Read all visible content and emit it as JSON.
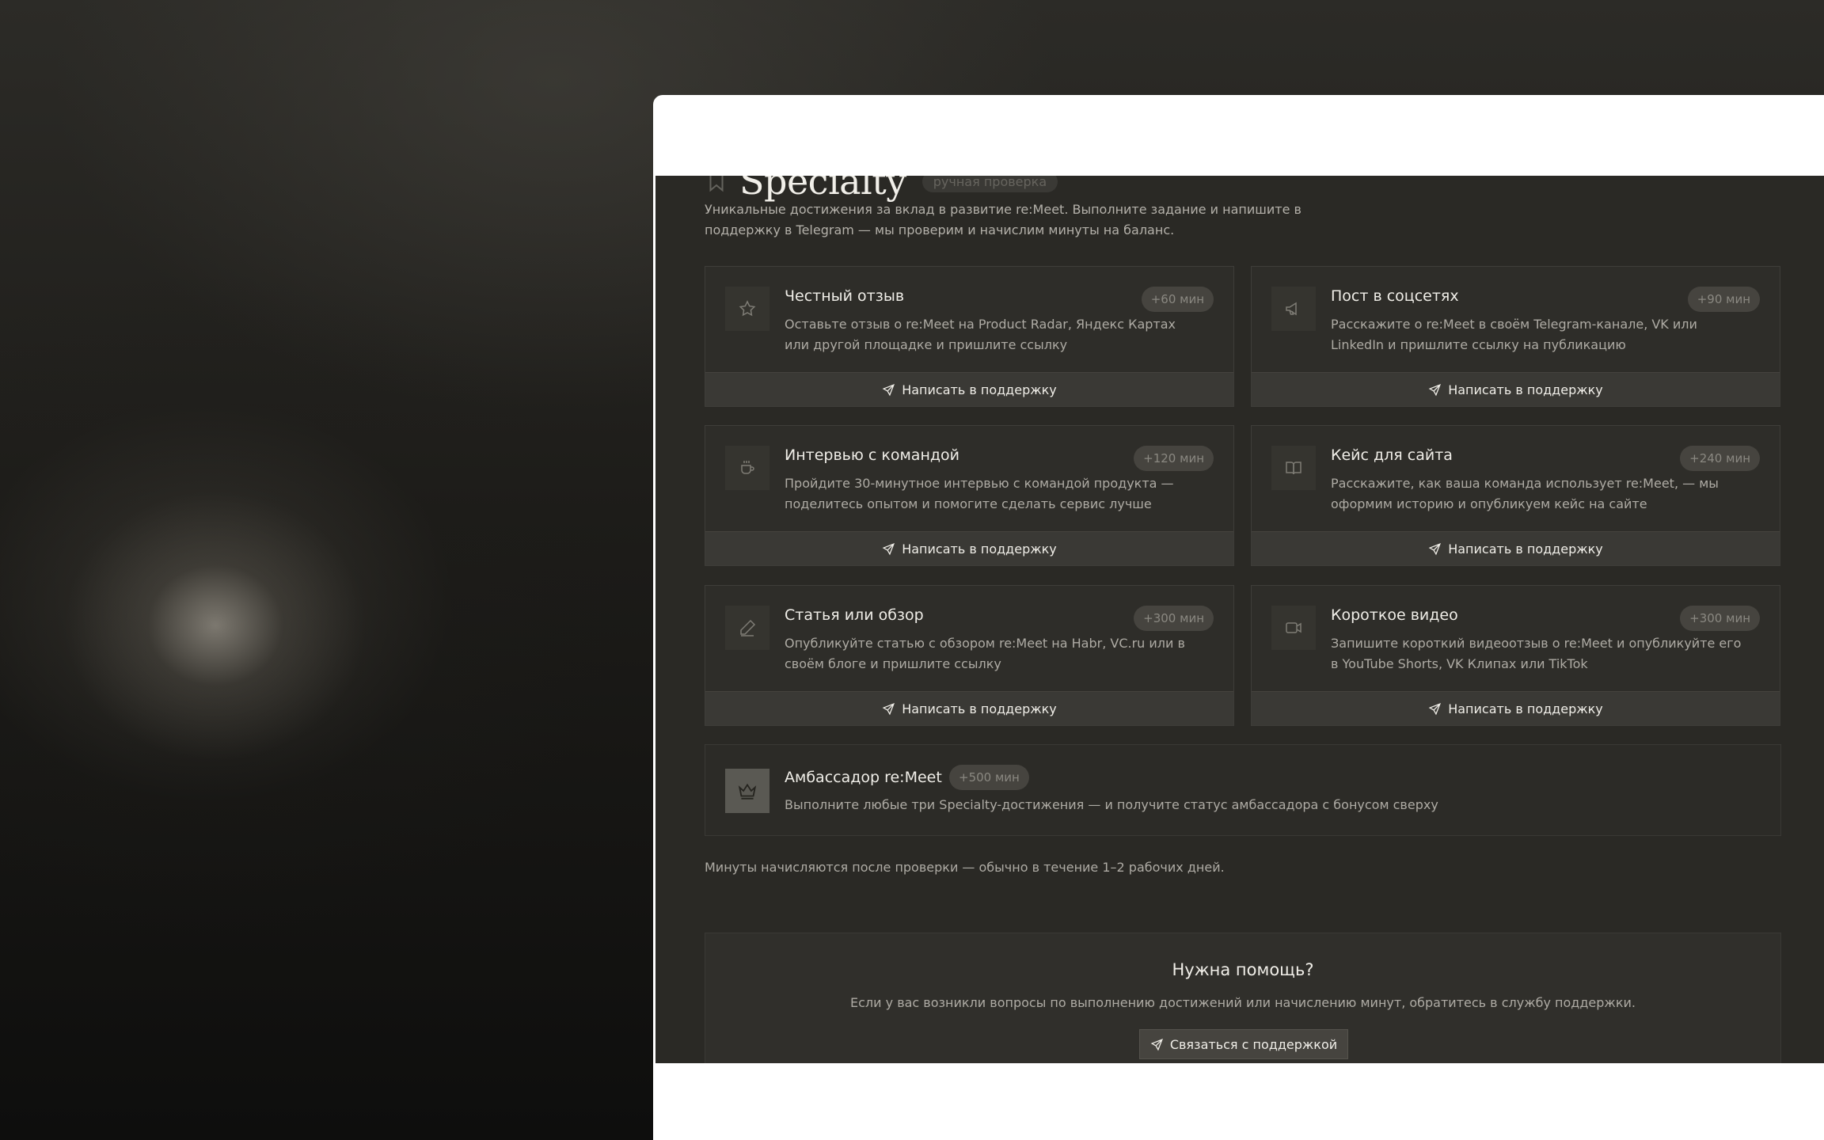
{
  "header": {
    "title": "Specialty",
    "badge": "ручная проверка",
    "intro": "Уникальные достижения за вклад в развитие re:Meet. Выполните задание и напишите в поддержку в Telegram — мы проверим и начислим минуты на баланс."
  },
  "cards": [
    {
      "icon": "star-icon",
      "title": "Честный отзыв",
      "reward": "+60 мин",
      "desc": "Оставьте отзыв о re:Meet на Product Radar, Яндекс Картах или другой площадке и пришлите ссылку",
      "button": "Написать в поддержку"
    },
    {
      "icon": "megaphone-icon",
      "title": "Пост в соцсетях",
      "reward": "+90 мин",
      "desc": "Расскажите о re:Meet в своём Telegram-канале, VK или LinkedIn и пришлите ссылку на публикацию",
      "button": "Написать в поддержку"
    },
    {
      "icon": "coffee-icon",
      "title": "Интервью с командой",
      "reward": "+120 мин",
      "desc": "Пройдите 30-минутное интервью с командой продукта — поделитесь опытом и помогите сделать сервис лучше",
      "button": "Написать в поддержку"
    },
    {
      "icon": "book-icon",
      "title": "Кейс для сайта",
      "reward": "+240 мин",
      "desc": "Расскажите, как ваша команда использует re:Meet, — мы оформим историю и опубликуем кейс на сайте",
      "button": "Написать в поддержку"
    },
    {
      "icon": "pen-icon",
      "title": "Статья или обзор",
      "reward": "+300 мин",
      "desc": "Опубликуйте статью с обзором re:Meet на Habr, VC.ru или в своём блоге и пришлите ссылку",
      "button": "Написать в поддержку"
    },
    {
      "icon": "video-icon",
      "title": "Короткое видео",
      "reward": "+300 мин",
      "desc": "Запишите короткий видеоотзыв о re:Meet и опубликуйте его в YouTube Shorts, VK Клипах или TikTok",
      "button": "Написать в поддержку"
    }
  ],
  "ambassador": {
    "icon": "crown-icon",
    "title": "Амбассадор re:Meet",
    "reward": "+500 мин",
    "desc": "Выполните любые три Specialty-достижения — и получите статус амбассадора с бонусом сверху"
  },
  "note": "Минуты начисляются после проверки — обычно в течение 1–2 рабочих дней.",
  "help": {
    "title": "Нужна помощь?",
    "desc": "Если у вас возникли вопросы по выполнению достижений или начислению минут, обратитесь в службу поддержки.",
    "button": "Связаться с поддержкой"
  }
}
